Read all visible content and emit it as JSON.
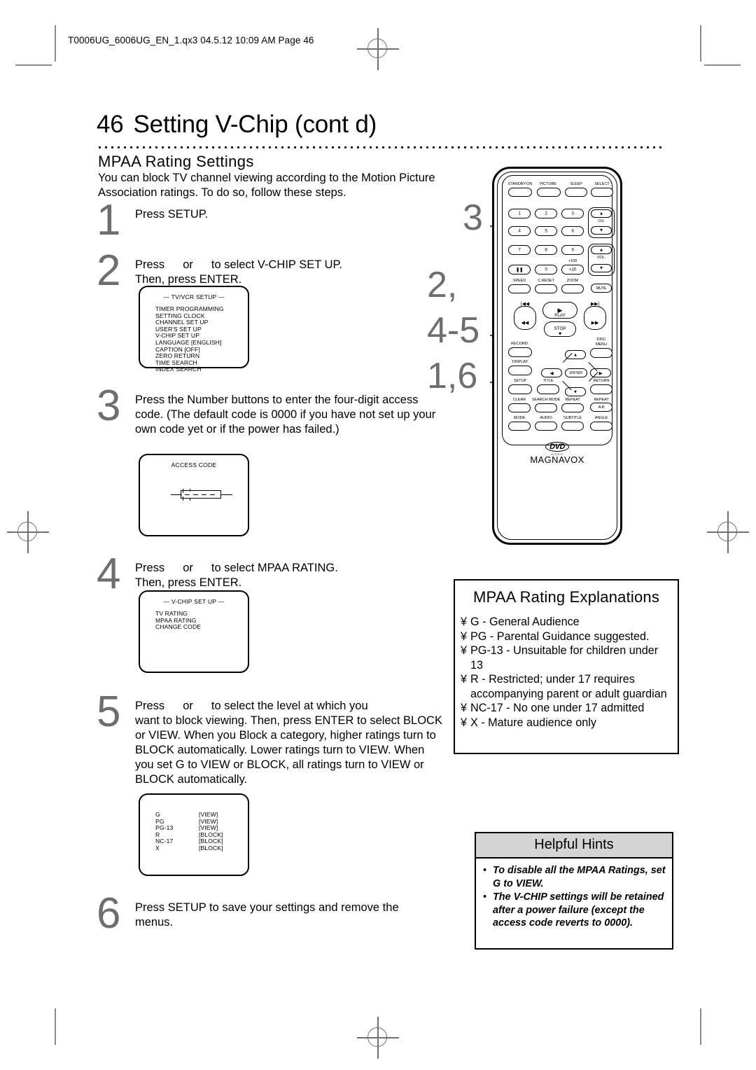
{
  "print_header": {
    "file_line": "T0006UG_6006UG_EN_1.qx3  04.5.12  10:09 AM  Page 46"
  },
  "page": {
    "number": "46",
    "title": "Setting V-Chip (cont d)",
    "section_heading": "MPAA Rating Settings",
    "intro": "You can block TV channel viewing according to the Motion Picture Association ratings. To do so, follow these steps."
  },
  "steps": [
    {
      "number": "1",
      "text": "Press SETUP."
    },
    {
      "number": "2",
      "line1_a": "Press",
      "line1_b": "or",
      "line1_c": "to select V-CHIP SET UP.",
      "line2": "Then, press ENTER."
    },
    {
      "number": "3",
      "text": "Press the Number buttons to enter the four-digit access code. (The default code is 0000 if you have not set up your own code yet or if the power has failed.)"
    },
    {
      "number": "4",
      "line1_a": "Press",
      "line1_b": "or",
      "line1_c": "to select MPAA RATING.",
      "line2": "Then, press ENTER."
    },
    {
      "number": "5",
      "line1_a": "Press",
      "line1_b": "or",
      "line1_c": "to select the level at which you",
      "line2": "want to block viewing. Then, press ENTER to select BLOCK or VIEW.",
      "line3": "When you Block a category, higher ratings turn to BLOCK automatically. Lower ratings turn to VIEW. When you set G to VIEW or BLOCK, all ratings turn to VIEW or BLOCK automatically."
    },
    {
      "number": "6",
      "text": "Press SETUP to save your settings and remove the menus."
    }
  ],
  "osd_screens": {
    "tv_vcr_setup": {
      "title": "— TV/VCR SETUP —",
      "items": [
        "TIMER PROGRAMMING",
        "SETTING CLOCK",
        "CHANNEL SET UP",
        "USER'S SET UP",
        "V-CHIP SET UP",
        "LANGUAGE  [ENGLISH]",
        "CAPTION  [OFF]",
        "ZERO RETURN",
        "TIME SEARCH",
        "INDEX SEARCH"
      ]
    },
    "access_code": {
      "title": "ACCESS CODE"
    },
    "vchip_setup": {
      "title": "— V-CHIP SET UP —",
      "items": [
        "TV RATING",
        "MPAA RATING",
        "CHANGE CODE"
      ]
    },
    "mpaa_ratings": {
      "rows": [
        {
          "rating": "G",
          "value": "[VIEW]"
        },
        {
          "rating": "PG",
          "value": "[VIEW]"
        },
        {
          "rating": "PG-13",
          "value": "[VIEW]"
        },
        {
          "rating": "R",
          "value": "[BLOCK]"
        },
        {
          "rating": "NC-17",
          "value": "[BLOCK]"
        },
        {
          "rating": "X",
          "value": "[BLOCK]"
        }
      ]
    }
  },
  "callouts": [
    {
      "label": "3"
    },
    {
      "label": "2,"
    },
    {
      "label": "4-5"
    },
    {
      "label": "1,6"
    }
  ],
  "remote": {
    "brand": "MAGNAVOX",
    "logo": "DVD",
    "logo_sub": "VIDEO",
    "row_top": [
      "STANDBY-ON",
      "PICTURE",
      "SLEEP",
      "SELECT"
    ],
    "keypad": [
      "1",
      "2",
      "3",
      "4",
      "5",
      "6",
      "7",
      "8",
      "9"
    ],
    "key_pause": "❚❚",
    "key_zero": "0",
    "key_plus10": "+10",
    "key_plus100": "+100",
    "ch_label": "CH.",
    "vol_label": "VOL.",
    "row_speed": [
      "SPEED",
      "C.RESET",
      "ZOOM"
    ],
    "mute": "MUTE",
    "play": "PLAY",
    "stop": "STOP",
    "skip_prev": "|◀◀",
    "skip_next": "▶▶|",
    "rew": "◀◀",
    "ff": "▶▶",
    "record": "RECORD",
    "disc_menu_l1": "DISC",
    "disc_menu_l2": "MENU",
    "display": "DISPLAY",
    "enter": "ENTER",
    "setup": "SETUP",
    "title": "TITLE",
    "return": "RETURN",
    "clear": "CLEAR",
    "search_mode": "SEARCH MODE",
    "repeat": "REPEAT",
    "repeat2": "REPEAT",
    "repeat_ab": "A-B",
    "mode": "MODE",
    "audio": "AUDIO",
    "subtitle": "SUBTITLE",
    "angle": "ANGLE"
  },
  "mpaa_explanations": {
    "title": "MPAA Rating Explanations",
    "bullet": "¥",
    "items": [
      "G - General Audience",
      "PG - Parental Guidance suggested.",
      "PG-13 - Unsuitable for children under 13",
      "R - Restricted; under 17 requires accompanying parent or adult guardian",
      "NC-17 - No one under 17 admitted",
      "X - Mature audience only"
    ]
  },
  "helpful_hints": {
    "title": "Helpful Hints",
    "bullet": "•",
    "items": [
      "To disable all the MPAA Ratings, set G to VIEW.",
      "The V-CHIP settings will be retained after a power failure (except the access code reverts to 0000)."
    ]
  }
}
